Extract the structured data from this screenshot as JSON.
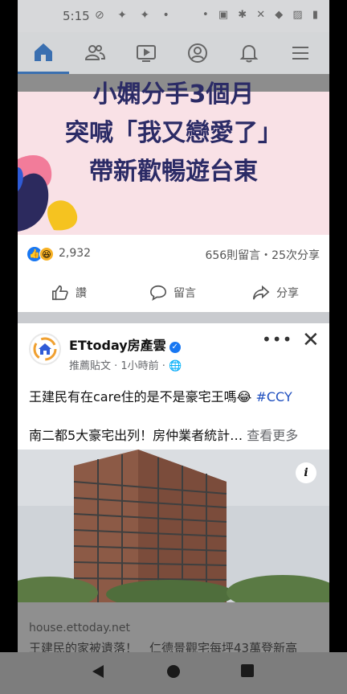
{
  "status_bar": {
    "time": "5:15",
    "left_icons": "⊘ ✦ ✦ •",
    "right_icons": "• ▣ ✱ ✕ ◆ ▨ ▮"
  },
  "top_nav": {
    "items": [
      {
        "name": "home-icon",
        "active": true
      },
      {
        "name": "friends-icon",
        "active": false
      },
      {
        "name": "watch-icon",
        "active": false
      },
      {
        "name": "profile-icon",
        "active": false
      },
      {
        "name": "notifications-icon",
        "active": false
      },
      {
        "name": "menu-icon",
        "active": false
      }
    ]
  },
  "post1": {
    "headline_lines": [
      "小嫻分手3個月",
      "突喊「我又戀愛了」",
      "帶新歡暢遊台東"
    ],
    "reaction_count": "2,932",
    "stats": "656則留言・25次分享",
    "actions": {
      "like": "讚",
      "comment": "留言",
      "share": "分享"
    }
  },
  "post2": {
    "page_name": "ETtoday房產雲",
    "meta": "推薦貼文 · 1小時前 ·",
    "text_line1": "王建民有在care住的是不是豪宅王嗎😂",
    "hashtag": "#CCY",
    "text_line2": "南二都5大豪宅出列！房仲業者統計…",
    "see_more": "查看更多",
    "more_label": "•••",
    "close_label": "✕"
  },
  "link_preview": {
    "domain": "house.ettoday.net",
    "title": "王建民的家被遺落！　仁德景觀宅每坪43萬登新高"
  },
  "colors": {
    "accent": "#1877f2",
    "headline": "#2b2b66",
    "hashtag": "#1f4fbf"
  }
}
